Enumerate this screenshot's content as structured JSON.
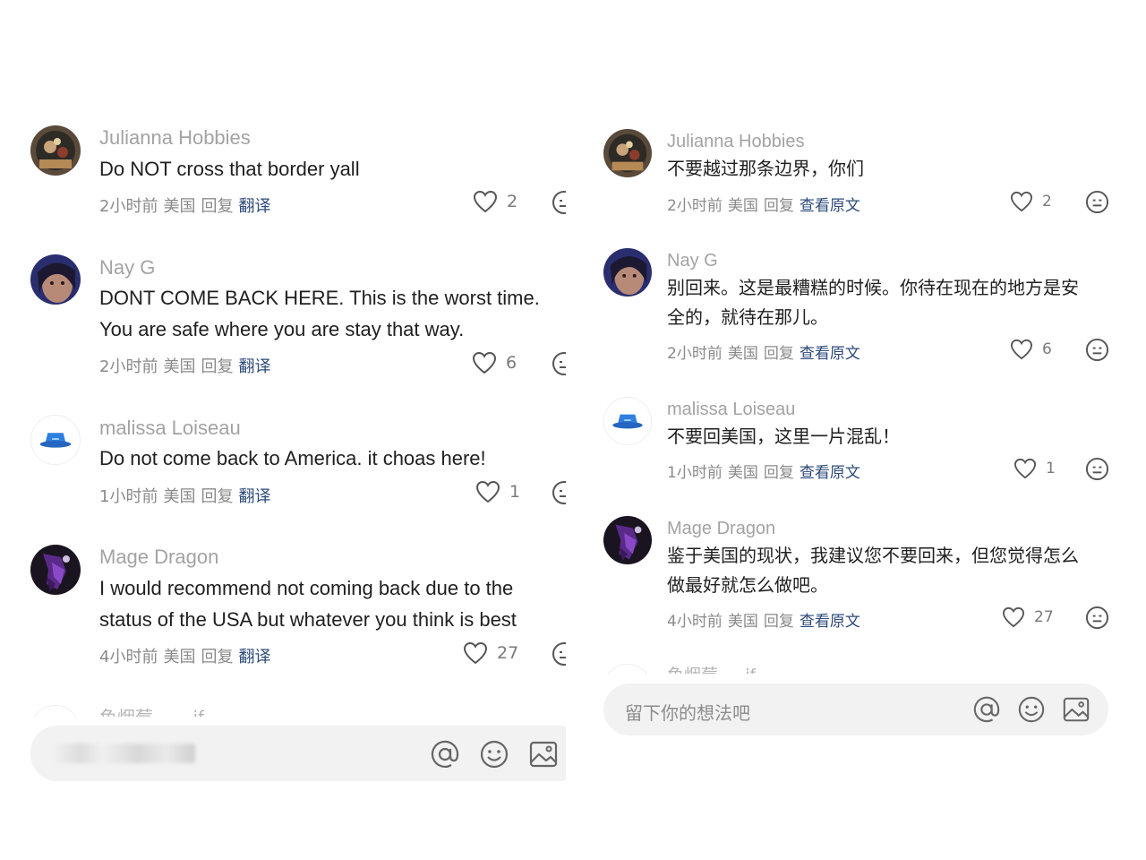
{
  "left": {
    "comments": [
      {
        "name": "Julianna Hobbies",
        "lines": [
          "Do NOT cross that border yall"
        ],
        "time": "2小时前",
        "location": "美国",
        "reply": "回复",
        "action": "翻译",
        "likes": "2"
      },
      {
        "name": "Nay G",
        "lines": [
          "DONT COME BACK HERE. This is the worst time.",
          "You are safe where you are stay that way."
        ],
        "time": "2小时前",
        "location": "美国",
        "reply": "回复",
        "action": "翻译",
        "likes": "6"
      },
      {
        "name": "malissa Loiseau",
        "lines": [
          "Do not come back to America. it choas here!"
        ],
        "time": "1小时前",
        "location": "美国",
        "reply": "回复",
        "action": "翻译",
        "likes": "1"
      },
      {
        "name": "Mage Dragon",
        "lines": [
          "I would recommend not coming back due to the",
          "status of the USA but whatever you think is best"
        ],
        "time": "4小时前",
        "location": "美国",
        "reply": "回复",
        "action": "翻译",
        "likes": "27"
      }
    ],
    "partial_name": "鱼烟莓 . . . if",
    "input": {
      "placeholder": ""
    }
  },
  "right": {
    "comments": [
      {
        "name": "Julianna Hobbies",
        "lines": [
          "不要越过那条边界，你们"
        ],
        "time": "2小时前",
        "location": "美国",
        "reply": "回复",
        "action": "查看原文",
        "likes": "2"
      },
      {
        "name": "Nay G",
        "lines": [
          "别回来。这是最糟糕的时候。你待在现在的地方是安",
          "全的，就待在那儿。"
        ],
        "time": "2小时前",
        "location": "美国",
        "reply": "回复",
        "action": "查看原文",
        "likes": "6"
      },
      {
        "name": "malissa Loiseau",
        "lines": [
          "不要回美国，这里一片混乱！"
        ],
        "time": "1小时前",
        "location": "美国",
        "reply": "回复",
        "action": "查看原文",
        "likes": "1"
      },
      {
        "name": "Mage Dragon",
        "lines": [
          "鉴于美国的现状，我建议您不要回来，但您觉得怎么",
          "做最好就怎么做吧。"
        ],
        "time": "4小时前",
        "location": "美国",
        "reply": "回复",
        "action": "查看原文",
        "likes": "27"
      }
    ],
    "partial_name": "鱼烟莓 . . if",
    "input": {
      "placeholder": "留下你的想法吧"
    }
  },
  "icons": {
    "like": "heart-outline-icon",
    "reaction": "neutral-face-icon",
    "mention": "at-sign-icon",
    "emoji": "smiley-icon",
    "image": "image-icon"
  },
  "colors": {
    "link": "#2d4a7a",
    "name": "#a3a3a3",
    "text": "#1f1f1f",
    "meta": "#8a8a8a",
    "input_bg": "#f2f2f2",
    "bucket_hat": "#2f7fe0"
  }
}
